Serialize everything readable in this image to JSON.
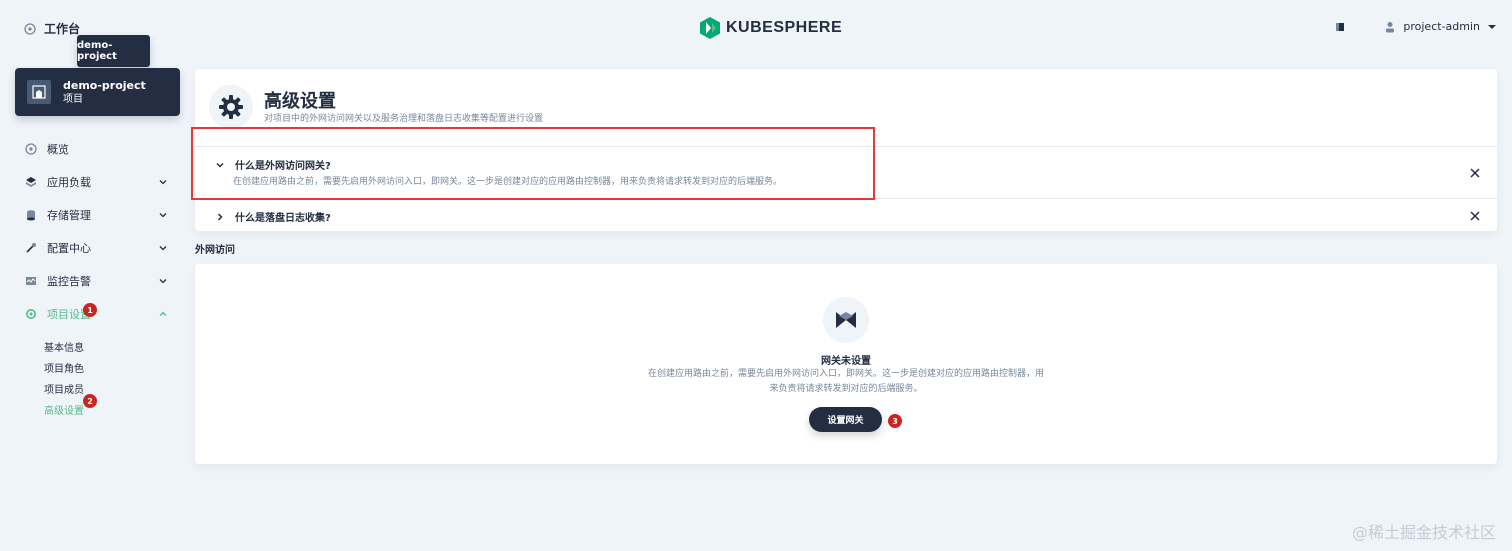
{
  "topbar": {
    "workbench_label": "工作台",
    "logo_text": "KUBESPHERE",
    "user_name": "project-admin"
  },
  "tooltip": {
    "text": "demo-project"
  },
  "project": {
    "name": "demo-project",
    "type": "项目"
  },
  "nav": {
    "items": [
      {
        "label": "概览"
      },
      {
        "label": "应用负载"
      },
      {
        "label": "存储管理"
      },
      {
        "label": "配置中心"
      },
      {
        "label": "监控告警"
      },
      {
        "label": "项目设置",
        "badge": "1"
      }
    ],
    "sub_items": [
      {
        "label": "基本信息"
      },
      {
        "label": "项目角色"
      },
      {
        "label": "项目成员"
      },
      {
        "label": "高级设置",
        "badge": "2"
      }
    ]
  },
  "header": {
    "title": "高级设置",
    "description": "对项目中的外网访问网关以及服务治理和落盘日志收集等配置进行设置"
  },
  "faq": [
    {
      "question": "什么是外网访问网关?",
      "answer": "在创建应用路由之前，需要先启用外网访问入口，即网关。这一步是创建对应的应用路由控制器，用来负责将请求转发到对应的后端服务。"
    },
    {
      "question": "什么是落盘日志收集?"
    }
  ],
  "section": {
    "label": "外网访问"
  },
  "empty": {
    "title": "网关未设置",
    "description": "在创建应用路由之前，需要先启用外网访问入口，即网关。这一步是创建对应的应用路由控制器，用来负责将请求转发到对应的后端服务。",
    "button_label": "设置网关",
    "badge": "3"
  },
  "watermark": "@稀土掘金技术社区",
  "colors": {
    "accent": "#55bc8a",
    "dark": "#242e42",
    "badge": "#ca2621",
    "highlight": "#e53935"
  },
  "icons": [
    "workbench-icon",
    "kubesphere-logo-icon",
    "notification-icon",
    "user-icon",
    "chevron-down-icon",
    "project-icon",
    "overview-icon",
    "workload-icon",
    "storage-icon",
    "config-icon",
    "monitor-icon",
    "settings-icon",
    "gear-icon",
    "close-icon",
    "gateway-icon"
  ]
}
